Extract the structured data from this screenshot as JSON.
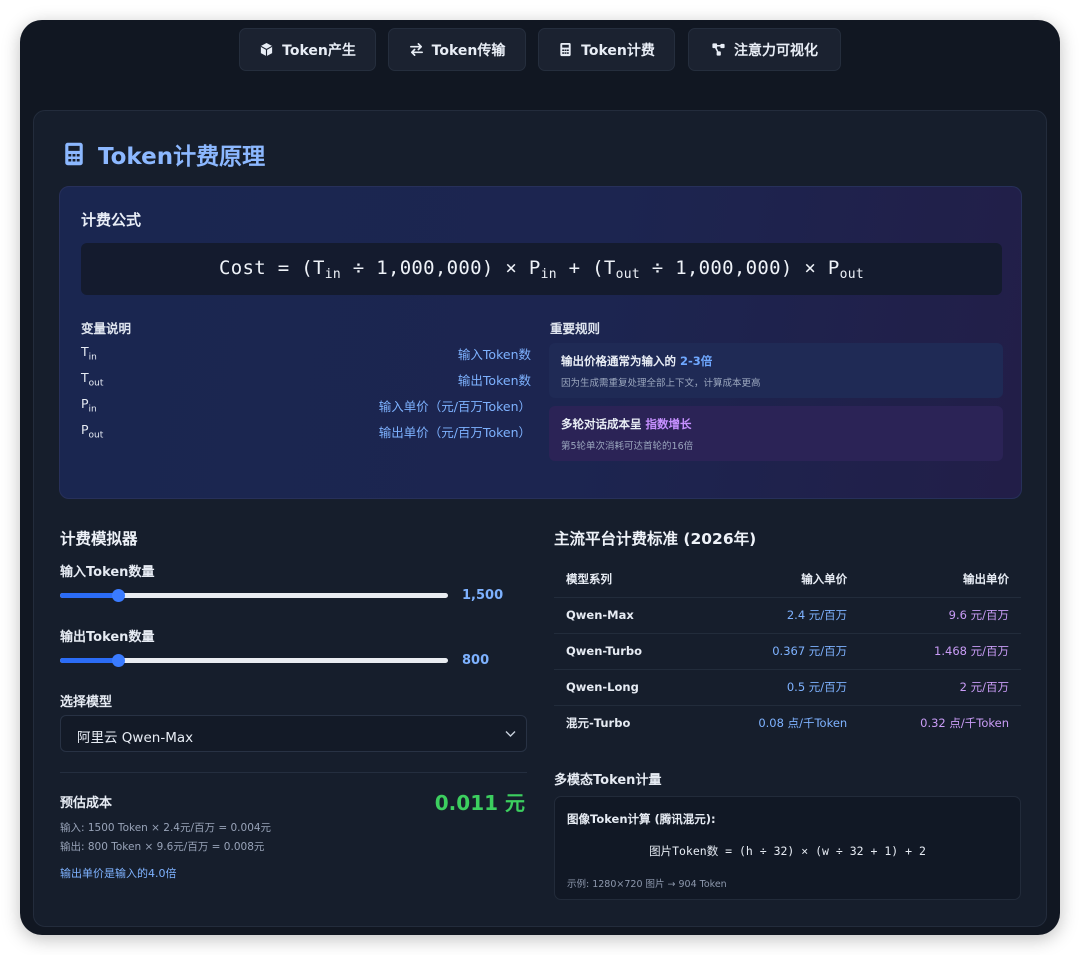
{
  "nav": {
    "items": [
      {
        "label": "Token产生",
        "icon": "cube-icon"
      },
      {
        "label": "Token传输",
        "icon": "swap-arrows-icon"
      },
      {
        "label": "Token计费",
        "icon": "calculator-icon"
      },
      {
        "label": "注意力可视化",
        "icon": "network-graph-icon"
      }
    ]
  },
  "page": {
    "title": "Token计费原理",
    "icon": "calculator-icon"
  },
  "formula_panel": {
    "heading": "计费公式",
    "formula": {
      "cost": "Cost",
      "t_in": "T",
      "t_in_sub": "in",
      "million": "1,000,000",
      "p_in": "P",
      "p_in_sub": "in",
      "t_out": "T",
      "t_out_sub": "out",
      "p_out": "P",
      "p_out_sub": "out"
    },
    "variables_heading": "变量说明",
    "variables": [
      {
        "sym": "T",
        "sub": "in",
        "desc": "输入Token数"
      },
      {
        "sym": "T",
        "sub": "out",
        "desc": "输出Token数"
      },
      {
        "sym": "P",
        "sub": "in",
        "desc": "输入单价（元/百万Token）"
      },
      {
        "sym": "P",
        "sub": "out",
        "desc": "输出单价（元/百万Token）"
      }
    ],
    "rules_heading": "重要规则",
    "rules": [
      {
        "title": "输出价格通常为输入的 ",
        "highlight": "2-3倍",
        "note": "因为生成需重复处理全部上下文，计算成本更高"
      },
      {
        "title": "多轮对话成本呈 ",
        "highlight": "指数增长",
        "note": "第5轮单次消耗可达首轮的16倍"
      }
    ]
  },
  "simulator": {
    "heading": "计费模拟器",
    "input_label": "输入Token数量",
    "input_value": "1,500",
    "input_fraction": 0.15,
    "output_label": "输出Token数量",
    "output_value": "800",
    "output_fraction": 0.15,
    "model_label": "选择模型",
    "model_selected": "阿里云 Qwen-Max",
    "cost_label": "预估成本",
    "cost_value": "0.011 元",
    "cost_in": "输入: 1500 Token × 2.4元/百万 = 0.004元",
    "cost_out": "输出: 800 Token × 9.6元/百万 = 0.008元",
    "ratio_note": "输出单价是输入的4.0倍"
  },
  "pricing": {
    "heading": "主流平台计费标准 (2026年)",
    "columns": [
      "模型系列",
      "输入单价",
      "输出单价"
    ],
    "rows": [
      [
        "Qwen-Max",
        "2.4 元/百万",
        "9.6 元/百万"
      ],
      [
        "Qwen-Turbo",
        "0.367 元/百万",
        "1.468 元/百万"
      ],
      [
        "Qwen-Long",
        "0.5 元/百万",
        "2 元/百万"
      ],
      [
        "混元-Turbo",
        "0.08 点/千Token",
        "0.32 点/千Token"
      ]
    ]
  },
  "multimodal": {
    "heading": "多模态Token计量",
    "title": "图像Token计算 (腾讯混元):",
    "formula": "图片Token数 = (h ÷ 32) × (w ÷ 32 + 1) + 2",
    "example": "示例: 1280×720 图片 → 904 Token"
  }
}
